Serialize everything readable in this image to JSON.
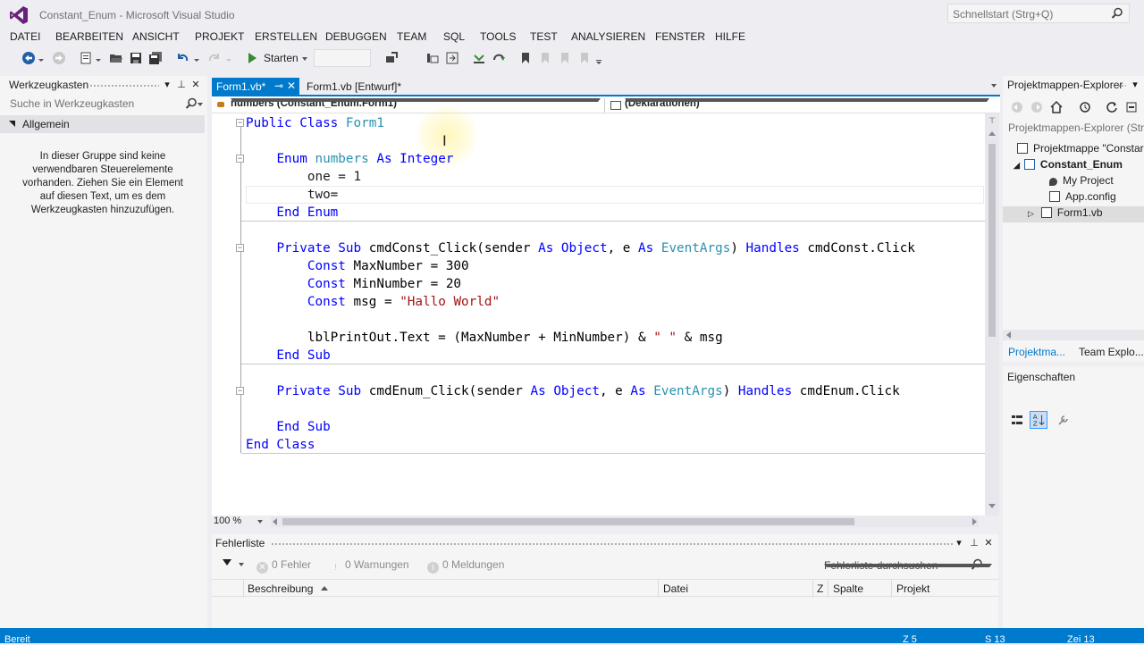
{
  "window": {
    "title": "Constant_Enum - Microsoft Visual Studio",
    "quicklaunch_placeholder": "Schnellstart (Strg+Q)"
  },
  "menu": [
    "DATEI",
    "BEARBEITEN",
    "ANSICHT",
    "PROJEKT",
    "ERSTELLEN",
    "DEBUGGEN",
    "TEAM",
    "SQL",
    "TOOLS",
    "TEST",
    "ANALYSIEREN",
    "FENSTER",
    "HILFE"
  ],
  "toolbar": {
    "start_label": "Starten",
    "config_value": ""
  },
  "toolbox": {
    "title": "Werkzeugkasten",
    "search_placeholder": "Suche in Werkzeugkasten",
    "group_label": "Allgemein",
    "empty_message": "In dieser Gruppe sind keine verwendbaren Steuerelemente vorhanden. Ziehen Sie ein Element auf diesen Text, um es dem Werkzeugkasten hinzuzufügen."
  },
  "editor": {
    "tabs": {
      "active": "Form1.vb*",
      "inactive": "Form1.vb [Entwurf]*"
    },
    "nav_left": "numbers (Constant_Enum.Form1)",
    "nav_right": "(Deklarationen)",
    "zoom": "100 %",
    "code": [
      "Public Class Form1",
      "",
      "    Enum numbers As Integer",
      "        one = 1",
      "        two=",
      "    End Enum",
      "",
      "    Private Sub cmdConst_Click(sender As Object, e As EventArgs) Handles cmdConst.Click",
      "        Const MaxNumber = 300",
      "        Const MinNumber = 20",
      "        Const msg = \"Hallo World\"",
      "",
      "        lblPrintOut.Text = (MaxNumber + MinNumber) & \" \" & msg",
      "    End Sub",
      "",
      "    Private Sub cmdEnum_Click(sender As Object, e As EventArgs) Handles cmdEnum.Click",
      "",
      "    End Sub",
      "End Class"
    ]
  },
  "errorlist": {
    "title": "Fehlerliste",
    "errors": "0 Fehler",
    "warnings": "0 Warnungen",
    "messages": "0 Meldungen",
    "search_placeholder": "Fehlerliste durchsuchen",
    "columns": [
      "Beschreibung",
      "Datei",
      "Z",
      "Spalte",
      "Projekt"
    ]
  },
  "solution_explorer": {
    "title": "Projektmappen-Explorer",
    "search_placeholder": "Projektmappen-Explorer (Strg",
    "tree": [
      {
        "label": "Projektmappe \"Constar"
      },
      {
        "label": "Constant_Enum"
      },
      {
        "label": "My Project"
      },
      {
        "label": "App.config"
      },
      {
        "label": "Form1.vb"
      }
    ],
    "tabs": [
      "Projektma...",
      "Team Explo..."
    ]
  },
  "properties": {
    "title": "Eigenschaften"
  },
  "statusbar": {
    "status": "Bereit",
    "line": "Z 5",
    "col": "S 13",
    "char": "Zei 13"
  },
  "colors": {
    "accent": "#007acc",
    "keyword": "#0000ff",
    "type": "#2b91af",
    "string": "#a31515"
  }
}
